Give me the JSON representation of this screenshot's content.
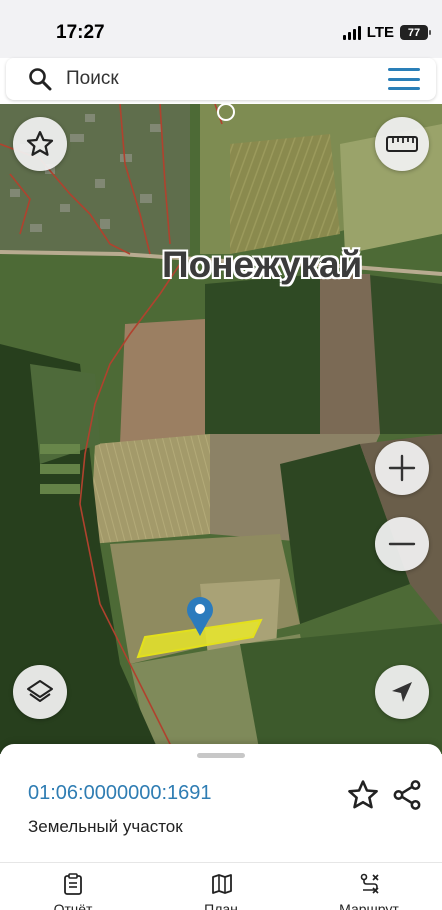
{
  "status_bar": {
    "time": "17:27",
    "network": "LTE",
    "battery": "77"
  },
  "search": {
    "placeholder": "Поиск",
    "icon": "search-icon",
    "menu_icon": "hamburger-menu-icon"
  },
  "map": {
    "place_label": "Понежукай",
    "buttons": {
      "favorite": "star-icon",
      "ruler": "ruler-icon",
      "zoom_in": "plus-icon",
      "zoom_out": "minus-icon",
      "layers": "layers-icon",
      "locate": "navigation-arrow-icon"
    },
    "colors": {
      "parcel_highlight": "#f2f021",
      "boundary_line": "#b0422e",
      "pin": "#2b7bbd"
    }
  },
  "sheet": {
    "cadastral_number": "01:06:0000000:1691",
    "parcel_type": "Земельный участок"
  },
  "tabbar": {
    "tabs": [
      {
        "label": "Отчёт",
        "icon": "report-icon"
      },
      {
        "label": "План",
        "icon": "map-plan-icon"
      },
      {
        "label": "Маршрут",
        "icon": "route-icon"
      }
    ]
  }
}
